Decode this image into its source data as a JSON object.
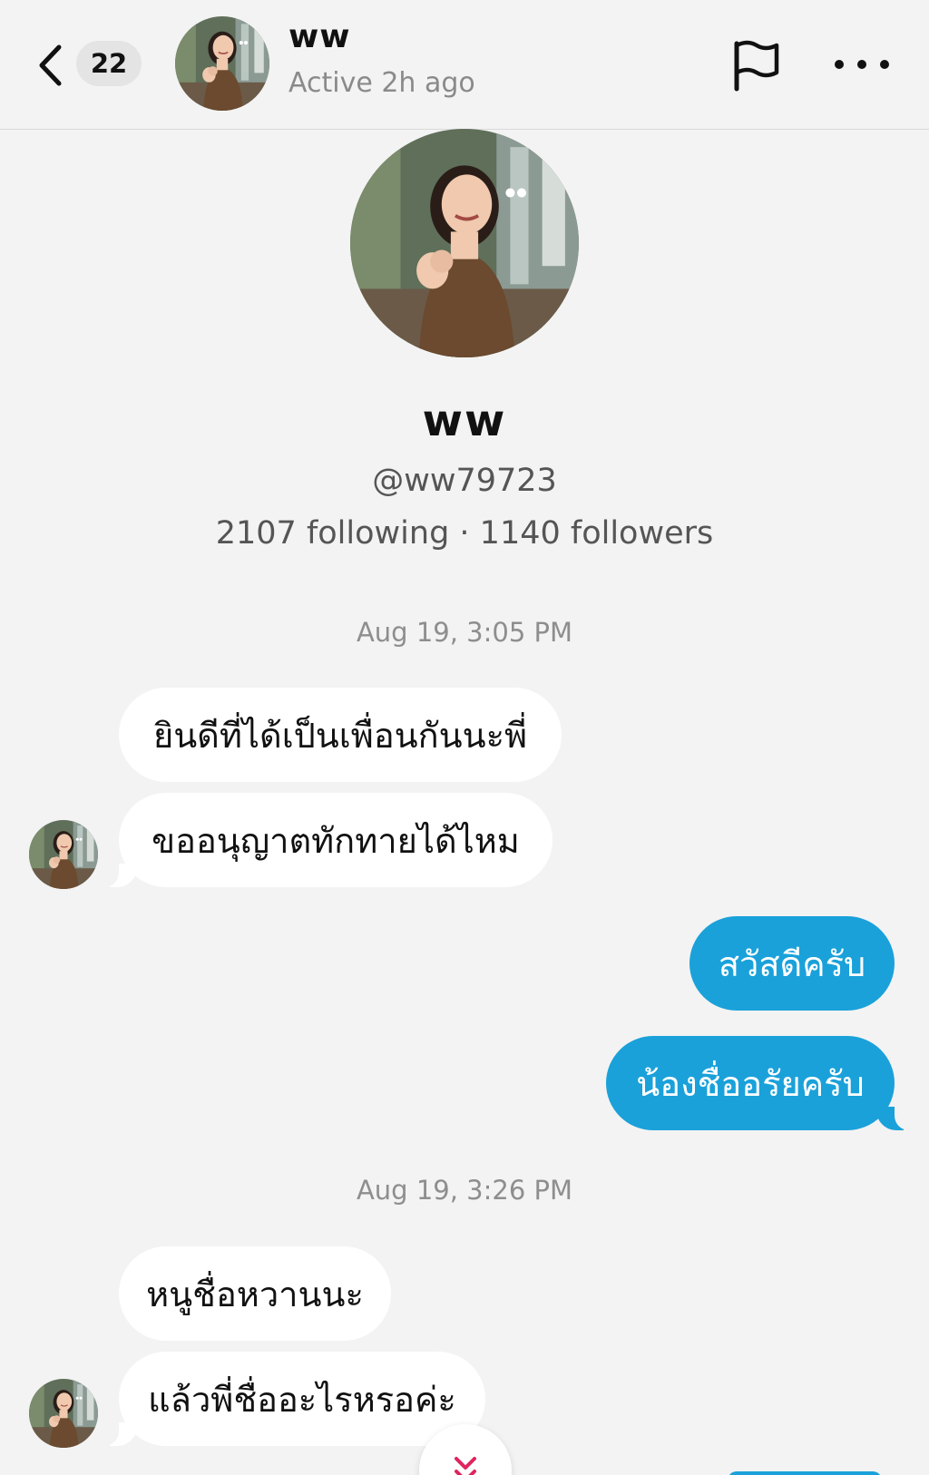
{
  "header": {
    "back_icon": "chevron-left-icon",
    "unread_count": "22",
    "name": "ww",
    "status": "Active 2h ago",
    "flag_icon": "flag-icon",
    "more_icon": "more-horizontal-icon"
  },
  "profile": {
    "name": "ww",
    "handle": "@ww79723",
    "stats": "2107 following · 1140 followers"
  },
  "thread": [
    {
      "timestamp": "Aug 19, 3:05 PM",
      "incoming": [
        "ยินดีที่ได้เป็นเพื่อนกันนะพี่",
        "ขออนุญาตทักทายได้ไหม"
      ],
      "outgoing": [
        "สวัสดีครับ",
        "น้องชื่ออรัยครับ"
      ]
    },
    {
      "timestamp": "Aug 19, 3:26 PM",
      "incoming": [
        "หนูชื่อหวานนะ",
        "แล้วพี่ชื่ออะไรหรอค่ะ"
      ]
    }
  ],
  "scroll_down_icon": "double-chevron-down-icon",
  "colors": {
    "background": "#f3f3f3",
    "outgoing_bubble": "#1aa1da",
    "incoming_bubble": "#ffffff",
    "scroll_icon": "#e0245e"
  }
}
